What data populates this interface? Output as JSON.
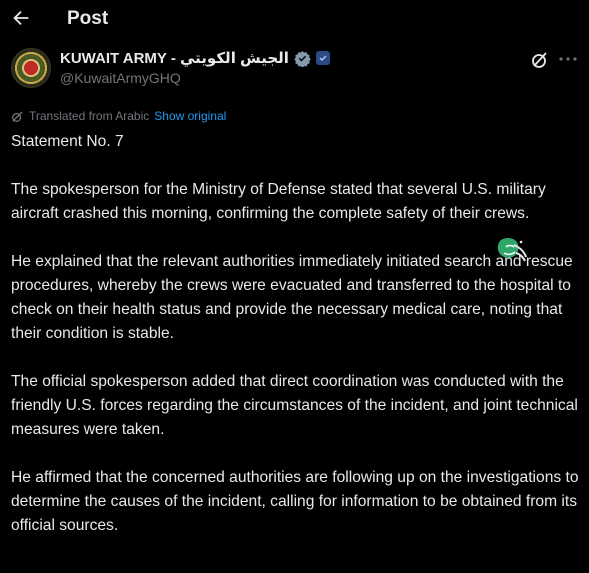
{
  "topbar": {
    "title": "Post"
  },
  "author": {
    "name": "KUWAIT ARMY - الجيش الكويتي",
    "handle": "@KuwaitArmyGHQ"
  },
  "translation": {
    "note": "Translated from Arabic",
    "show_original": "Show original"
  },
  "post": {
    "paragraphs": [
      "Statement No. 7",
      "The spokesperson for the Ministry of Defense stated that several U.S. military aircraft crashed this morning, confirming the complete safety of their crews.",
      "He explained that the relevant authorities immediately initiated search and rescue procedures, whereby the crews were evacuated and transferred to the hospital to check on their health status and provide the necessary medical care, noting that their condition is stable.",
      "The official spokesperson added that direct coordination was conducted with the friendly U.S. forces regarding the circumstances of the incident, and joint technical measures were taken.",
      "He affirmed that the concerned authorities are following up on the investigations to determine the causes of the incident, calling for information to be obtained from its official sources."
    ]
  },
  "icons": {
    "back": "arrow-left-icon",
    "verified": "verified-badge-icon",
    "affiliate": "affiliate-badge-icon",
    "grok": "grok-icon",
    "more": "more-icon",
    "translate": "translate-icon"
  },
  "colors": {
    "background": "#000000",
    "text": "#e7e9ea",
    "muted": "#71767b",
    "link": "#1d9bf0"
  }
}
